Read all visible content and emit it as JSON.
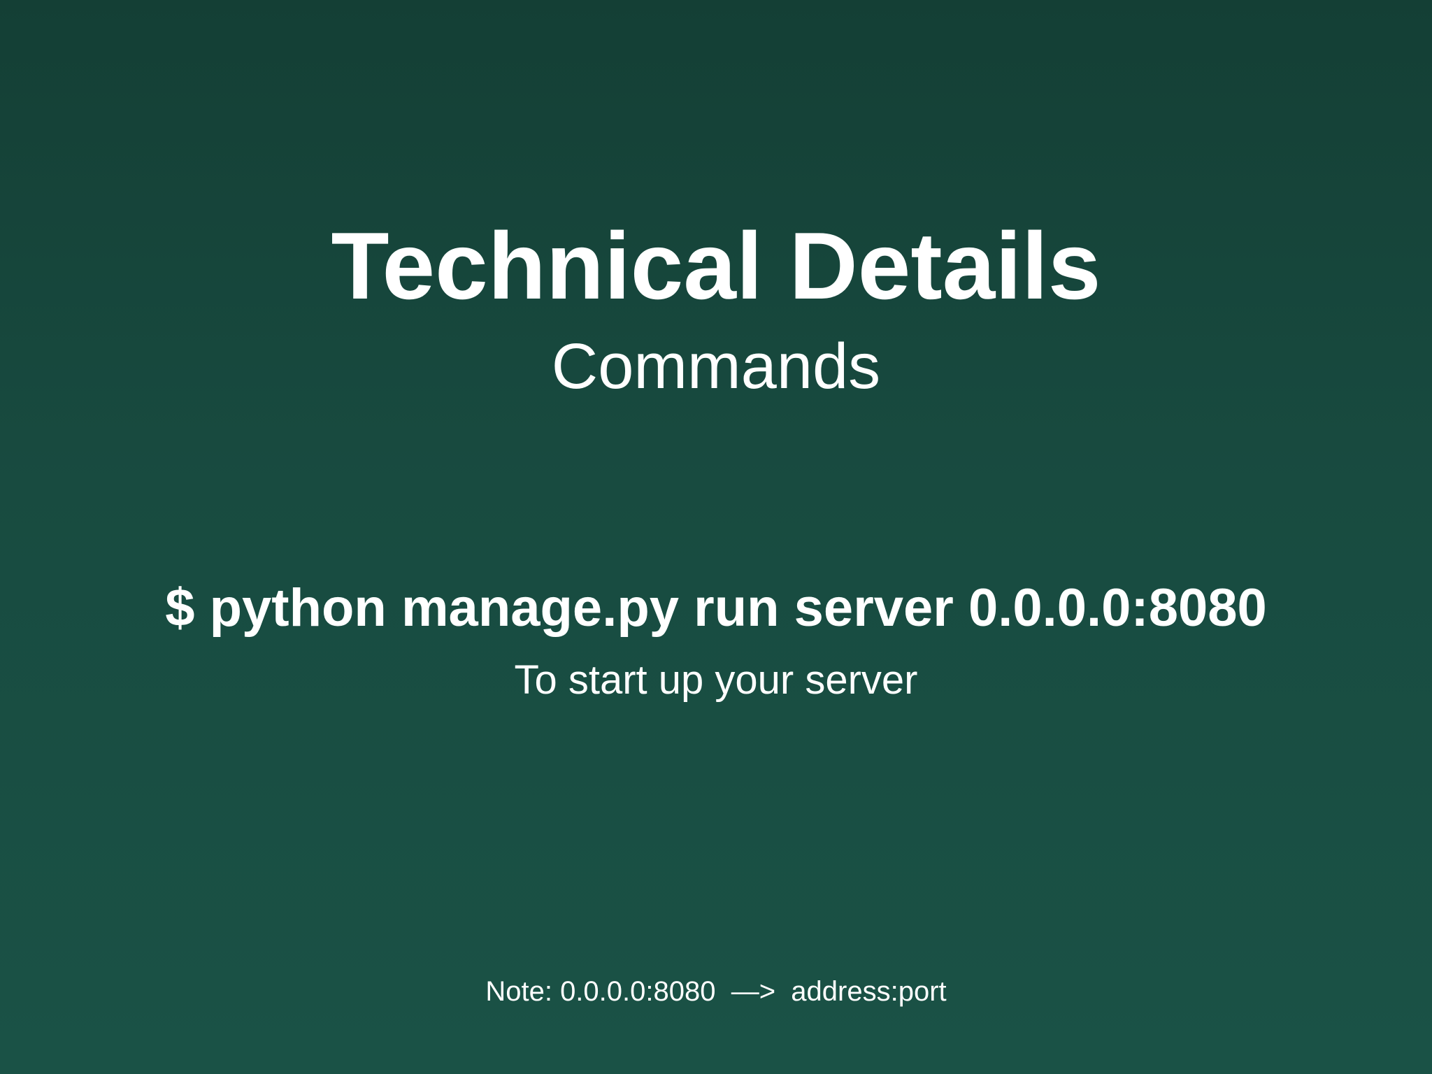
{
  "slide": {
    "title": "Technical Details",
    "subtitle": "Commands",
    "command": "$ python manage.py run server 0.0.0.0:8080",
    "command_description": "To start up your server",
    "note": "Note: 0.0.0.0:8080  —>  address:port"
  },
  "colors": {
    "background_top": "#143f35",
    "background_bottom": "#1a5246",
    "text": "#ffffff"
  }
}
